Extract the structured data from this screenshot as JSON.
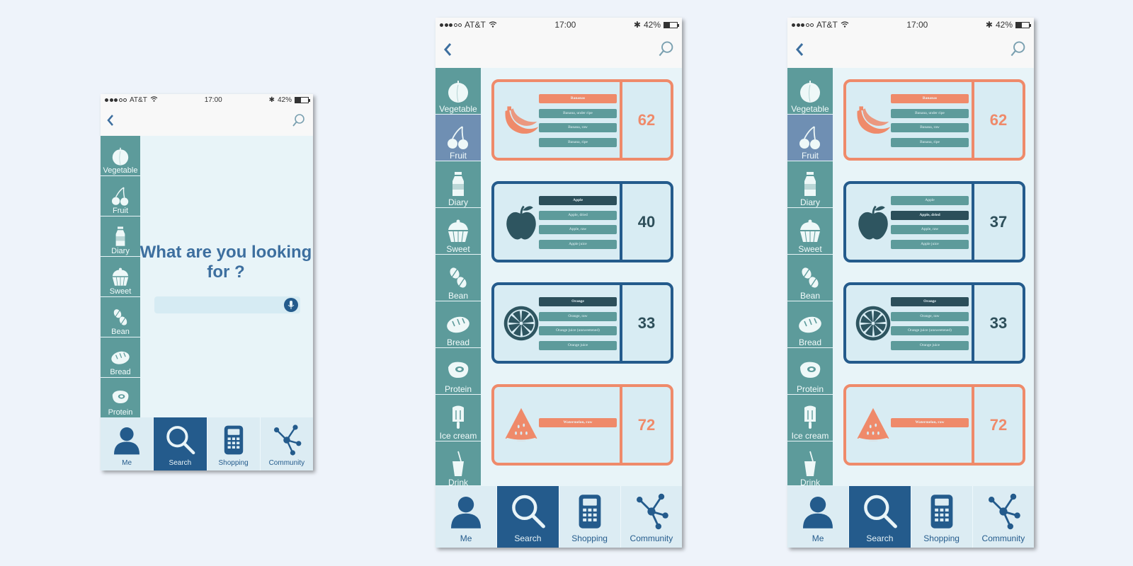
{
  "status": {
    "carrier": "AT&T",
    "time": "17:00",
    "battery": "42%",
    "battery_level": 0.42
  },
  "colors": {
    "background": "#eef3fa",
    "screen": "#e8f4f8",
    "sidebar": "#5d9b9b",
    "sidebar_active": "#6f8fb3",
    "nav_active": "#245b8c",
    "accent_orange": "#ef8a6a",
    "accent_blue": "#245b8c",
    "title_blue": "#3d6f9f"
  },
  "categories": [
    {
      "label": "Vegetable",
      "icon": "tomato-icon"
    },
    {
      "label": "Fruit",
      "icon": "cherry-icon"
    },
    {
      "label": "Diary",
      "icon": "milk-bottle-icon"
    },
    {
      "label": "Sweet",
      "icon": "cupcake-icon"
    },
    {
      "label": "Bean",
      "icon": "coffee-bean-icon"
    },
    {
      "label": "Bread",
      "icon": "bread-icon"
    },
    {
      "label": "Protein",
      "icon": "steak-icon"
    },
    {
      "label": "Ice cream",
      "icon": "popsicle-icon"
    },
    {
      "label": "Drink",
      "icon": "drink-cup-icon"
    }
  ],
  "nav": [
    {
      "label": "Me",
      "icon": "person-icon"
    },
    {
      "label": "Search",
      "icon": "magnifier-icon"
    },
    {
      "label": "Shopping",
      "icon": "calculator-icon"
    },
    {
      "label": "Community",
      "icon": "network-icon"
    }
  ],
  "screen1": {
    "title": "What are you looking for ?",
    "search_placeholder": ""
  },
  "screen2": {
    "cards": [
      {
        "icon": "banana-icon",
        "color": "orange",
        "score": "62",
        "items": [
          "Bananas",
          "Banana, under ripe",
          "Banana, raw",
          "Banana, ripe"
        ],
        "selected": 0
      },
      {
        "icon": "apple-icon",
        "color": "blue",
        "score": "40",
        "items": [
          "Apple",
          "Apple, dried",
          "Apple, raw",
          "Apple juice"
        ],
        "selected": 0
      },
      {
        "icon": "orange-slice-icon",
        "color": "blue",
        "score": "33",
        "items": [
          "Orange",
          "Orange, raw",
          "Orange juice (unsweetened)",
          "Orange juice"
        ],
        "selected": 0
      },
      {
        "icon": "watermelon-icon",
        "color": "orange",
        "score": "72",
        "items": [
          "Watermelon, raw"
        ],
        "selected": 0
      }
    ]
  },
  "screen3": {
    "cards": [
      {
        "icon": "banana-icon",
        "color": "orange",
        "score": "62",
        "items": [
          "Bananas",
          "Banana, under ripe",
          "Banana, raw",
          "Banana, ripe"
        ],
        "selected": 0
      },
      {
        "icon": "apple-icon",
        "color": "blue",
        "score": "37",
        "items": [
          "Apple",
          "Apple, dried",
          "Apple, raw",
          "Apple juice"
        ],
        "selected": 1
      },
      {
        "icon": "orange-slice-icon",
        "color": "blue",
        "score": "33",
        "items": [
          "Orange",
          "Orange, raw",
          "Orange juice (unsweetened)",
          "Orange juice"
        ],
        "selected": 0
      },
      {
        "icon": "watermelon-icon",
        "color": "orange",
        "score": "72",
        "items": [
          "Watermelon, raw"
        ],
        "selected": 0
      }
    ]
  }
}
